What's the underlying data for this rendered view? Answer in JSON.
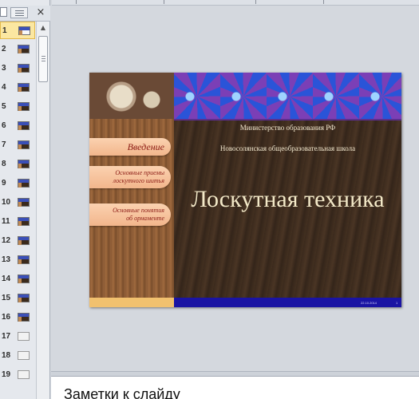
{
  "thumbnails": [
    {
      "number": "1",
      "active": true,
      "has_content": true
    },
    {
      "number": "2",
      "active": false,
      "has_content": true
    },
    {
      "number": "3",
      "active": false,
      "has_content": true
    },
    {
      "number": "4",
      "active": false,
      "has_content": true
    },
    {
      "number": "5",
      "active": false,
      "has_content": true
    },
    {
      "number": "6",
      "active": false,
      "has_content": true
    },
    {
      "number": "7",
      "active": false,
      "has_content": true
    },
    {
      "number": "8",
      "active": false,
      "has_content": true
    },
    {
      "number": "9",
      "active": false,
      "has_content": true
    },
    {
      "number": "10",
      "active": false,
      "has_content": true
    },
    {
      "number": "11",
      "active": false,
      "has_content": true
    },
    {
      "number": "12",
      "active": false,
      "has_content": true
    },
    {
      "number": "13",
      "active": false,
      "has_content": true
    },
    {
      "number": "14",
      "active": false,
      "has_content": true
    },
    {
      "number": "15",
      "active": false,
      "has_content": true
    },
    {
      "number": "16",
      "active": false,
      "has_content": true
    },
    {
      "number": "17",
      "active": false,
      "has_content": false
    },
    {
      "number": "18",
      "active": false,
      "has_content": false
    },
    {
      "number": "19",
      "active": false,
      "has_content": false
    }
  ],
  "pane": {
    "close_glyph": "×"
  },
  "slide": {
    "ministry": "Министерство образования РФ",
    "school": "Новосолянская общеобразовательная школа",
    "title": "Лоскутная техника",
    "nav_intro": "Введение",
    "nav_basics_line1": "Основные приемы",
    "nav_basics_line2": "лоскутного шитья",
    "nav_concepts_line1": "Основные понятия",
    "nav_concepts_line2": "об орнаменте",
    "footer_date": "22.10.2014",
    "footer_page": "1"
  },
  "notes": {
    "placeholder": "Заметки к слайду"
  },
  "colors": {
    "active_thumb": "#fbe7a1",
    "title_text": "#f3e9c8",
    "nav_text": "#8b1a14",
    "footer_bar": "#1a14a3"
  }
}
